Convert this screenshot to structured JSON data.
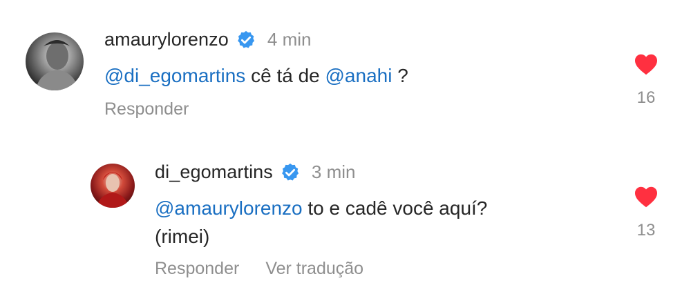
{
  "comments": [
    {
      "username": "amaurylorenzo",
      "time": "4 min",
      "text": [
        {
          "type": "mention",
          "value": "@di_egomartins"
        },
        {
          "type": "text",
          "value": " cê tá de "
        },
        {
          "type": "mention",
          "value": "@anahi"
        },
        {
          "type": "text",
          "value": " ?"
        }
      ],
      "actions": [
        "Responder"
      ],
      "likes": "16"
    },
    {
      "username": "di_egomartins",
      "time": "3 min",
      "text_line1": [
        {
          "type": "mention",
          "value": "@amaurylorenzo"
        },
        {
          "type": "text",
          "value": " to e cadê você aquí?"
        }
      ],
      "text_line2": "(rimei)",
      "actions": [
        "Responder",
        "Ver tradução"
      ],
      "likes": "13"
    }
  ],
  "colors": {
    "mention": "#1a6fc2",
    "like": "#ff3040",
    "verified": "#3897f0",
    "muted": "#8e8e8e"
  },
  "icons": {
    "verified": "verified-badge-icon",
    "like": "heart-filled-icon"
  }
}
